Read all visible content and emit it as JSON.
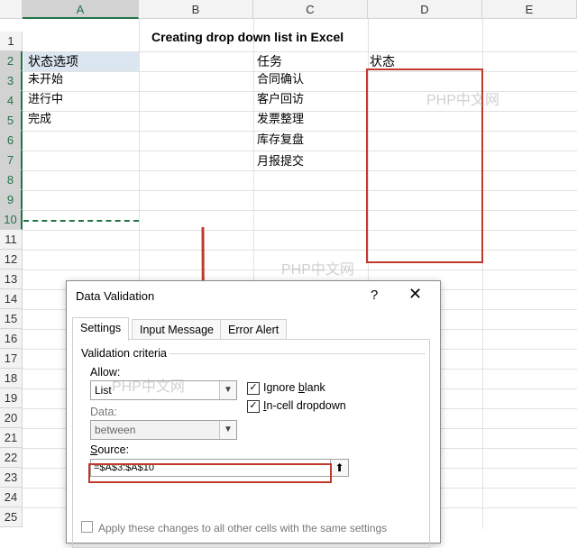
{
  "columns": [
    "A",
    "B",
    "C",
    "D",
    "E"
  ],
  "rows": [
    "1",
    "2",
    "3",
    "4",
    "5",
    "6",
    "7",
    "8",
    "9",
    "10",
    "11",
    "12",
    "13",
    "14",
    "15",
    "16",
    "17",
    "18",
    "19",
    "20",
    "21",
    "22",
    "23",
    "24",
    "25"
  ],
  "cells": {
    "title": "Creating drop down list in Excel",
    "a2": "状态选项",
    "a3": "未开始",
    "a4": "进行中",
    "a5": "完成",
    "c2": "任务",
    "c3": "合同确认",
    "c4": "客户回访",
    "c5": "发票整理",
    "c6": "库存复盘",
    "c7": "月报提交",
    "d2": "状态"
  },
  "watermark": "PHP中文网",
  "dialog": {
    "title": "Data Validation",
    "help": "?",
    "close": "✕",
    "tabs": [
      "Settings",
      "Input Message",
      "Error Alert"
    ],
    "active_tab": "Settings",
    "section": "Validation criteria",
    "allow_label": "Allow:",
    "allow_value": "List",
    "data_label": "Data:",
    "data_value": "between",
    "ignore_blank_label": "Ignore blank",
    "ignore_blank_checked": true,
    "in_cell_dropdown_label": "In-cell dropdown",
    "in_cell_dropdown_checked": true,
    "source_label": "Source:",
    "source_value": "=$A$3:$A$10",
    "apply_text": "Apply these changes to all other cells with the same settings"
  },
  "colors": {
    "excel_green": "#217346",
    "annotation_red": "#c0392b",
    "selection_blue": "#dce6f1"
  },
  "icons": {
    "dropdown": "chevron-down-icon",
    "collapse": "range-select-icon",
    "check": "check-icon",
    "close": "close-icon",
    "help": "help-icon",
    "arrow": "arrow-down-annotation"
  }
}
